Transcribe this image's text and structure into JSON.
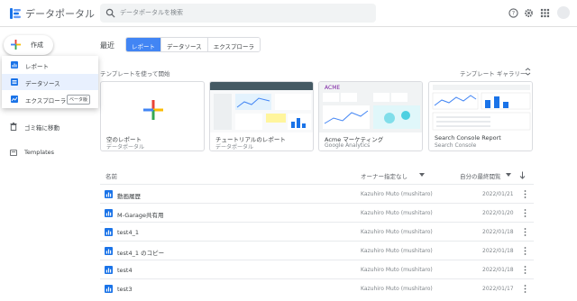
{
  "header": {
    "app_title": "データポータル",
    "search_placeholder": "データポータルを検索",
    "icons": [
      "help-icon",
      "settings-icon",
      "apps-grid-icon",
      "account-avatar"
    ]
  },
  "sidebar": {
    "create_label": "作成",
    "dropdown": [
      {
        "label": "レポート",
        "icon": "report-icon"
      },
      {
        "label": "データソース",
        "icon": "datasource-icon"
      },
      {
        "label": "エクスプローラ",
        "icon": "explorer-icon",
        "badge": "ベータ版"
      }
    ],
    "items": [
      {
        "label": "ゴミ箱に移動",
        "icon": "trash-icon"
      },
      {
        "label": "Templates",
        "icon": "templates-icon"
      }
    ]
  },
  "main": {
    "title": "最近",
    "tabs": [
      {
        "label": "レポート",
        "active": true
      },
      {
        "label": "データソース",
        "active": false
      },
      {
        "label": "エクスプローラ",
        "active": false
      }
    ],
    "template_heading": "テンプレートを使って開始",
    "template_gallery": "テンプレート ギャラリー",
    "templates": [
      {
        "title": "空のレポート",
        "subtitle": "データポータル"
      },
      {
        "title": "チュートリアルのレポート",
        "subtitle": "データポータル"
      },
      {
        "title": "Acme マーケティング",
        "subtitle": "Google Analytics",
        "thumb_label": "ACME"
      },
      {
        "title": "Search Console Report",
        "subtitle": "Search Console"
      }
    ],
    "table": {
      "headers": {
        "name": "名前",
        "owner": "オーナー指定なし",
        "date": "自分の最終閲覧"
      },
      "rows": [
        {
          "name": "動画履歴",
          "owner": "Kazuhiro Muto (mushitaro)",
          "date": "2022/01/21"
        },
        {
          "name": "M-Garage共有用",
          "owner": "Kazuhiro Muto (mushitaro)",
          "date": "2022/01/20"
        },
        {
          "name": "test4_1",
          "owner": "Kazuhiro Muto (mushitaro)",
          "date": "2022/01/18"
        },
        {
          "name": "test4_1 のコピー",
          "owner": "Kazuhiro Muto (mushitaro)",
          "date": "2022/01/18"
        },
        {
          "name": "test4",
          "owner": "Kazuhiro Muto (mushitaro)",
          "date": "2022/01/18"
        },
        {
          "name": "test3",
          "owner": "Kazuhiro Muto (mushitaro)",
          "date": "2022/01/17"
        }
      ]
    }
  },
  "colors": {
    "accent": "#4285f4",
    "google_red": "#ea4335",
    "google_yellow": "#fbbc04",
    "google_green": "#34a853",
    "report_blue": "#1a73e8"
  }
}
